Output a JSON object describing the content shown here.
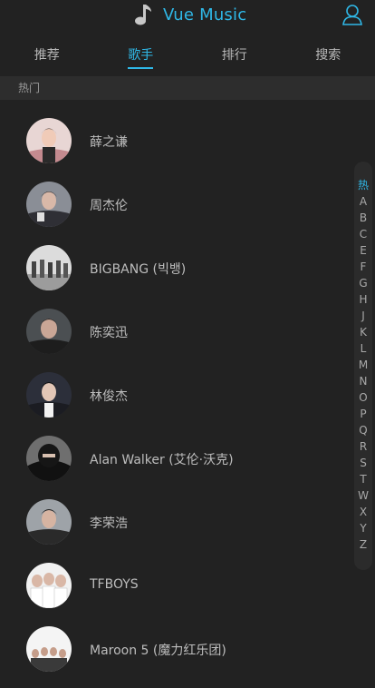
{
  "header": {
    "title": "Vue Music",
    "logo_icon": "music-note-icon",
    "user_icon": "user-icon"
  },
  "tabs": [
    {
      "label": "推荐",
      "active": false
    },
    {
      "label": "歌手",
      "active": true
    },
    {
      "label": "排行",
      "active": false
    },
    {
      "label": "搜索",
      "active": false
    }
  ],
  "section": {
    "title": "热门"
  },
  "singers": [
    {
      "name": "薛之谦"
    },
    {
      "name": "周杰伦"
    },
    {
      "name": "BIGBANG (빅뱅)"
    },
    {
      "name": "陈奕迅"
    },
    {
      "name": "林俊杰"
    },
    {
      "name": "Alan Walker (艾伦·沃克)"
    },
    {
      "name": "李荣浩"
    },
    {
      "name": "TFBOYS"
    },
    {
      "name": "Maroon 5 (魔力红乐团)"
    }
  ],
  "index": [
    "热",
    "A",
    "B",
    "C",
    "E",
    "F",
    "G",
    "H",
    "J",
    "K",
    "L",
    "M",
    "N",
    "O",
    "P",
    "Q",
    "R",
    "S",
    "T",
    "W",
    "X",
    "Y",
    "Z"
  ],
  "index_active": "热",
  "colors": {
    "accent": "#2fb8e7",
    "background": "#222222",
    "section_bg": "#2d2d2d"
  }
}
